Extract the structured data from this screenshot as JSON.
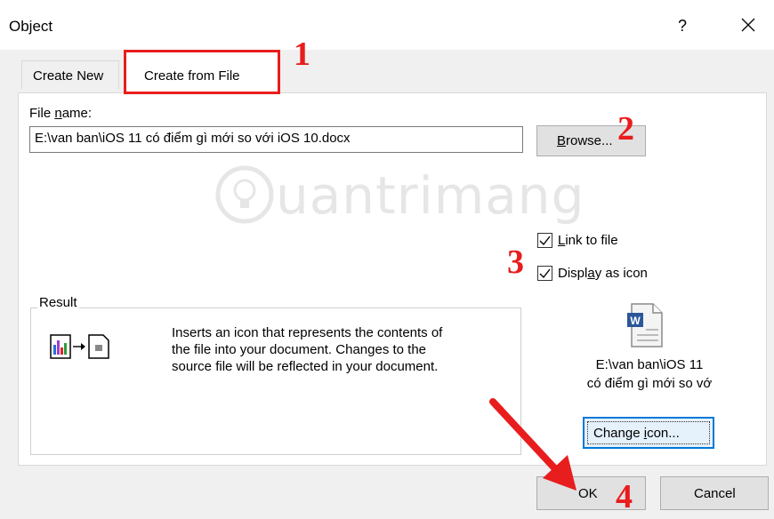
{
  "window": {
    "title": "Object",
    "help": "?"
  },
  "tabs": [
    {
      "label": "Create New"
    },
    {
      "label": "Create from File"
    }
  ],
  "file": {
    "label_pre": "File ",
    "label_key": "n",
    "label_post": "ame:",
    "value": "E:\\van ban\\iOS 11 có điểm gì mới so với iOS 10.docx"
  },
  "browse": {
    "key": "B",
    "rest": "rowse..."
  },
  "watermark": {
    "text": "uantrimang"
  },
  "options": {
    "link": {
      "key": "L",
      "rest": "ink to file",
      "checked": true
    },
    "display": {
      "pre": "Displ",
      "key": "a",
      "post": "y as icon",
      "checked": true
    }
  },
  "result": {
    "label": "Result",
    "description_lines": [
      "Inserts an icon that represents the contents of",
      "the file into your document. Changes to the",
      "source file will be reflected in your document."
    ]
  },
  "icon_caption": [
    "E:\\van ban\\iOS 11",
    "có điểm gì mới so vớ"
  ],
  "change_icon": {
    "pre": "Change ",
    "key": "i",
    "post": "con..."
  },
  "buttons": {
    "ok": "OK",
    "cancel": "Cancel"
  },
  "annotations": [
    "1",
    "2",
    "3",
    "4"
  ],
  "colors": {
    "annotation_red": "#e81d1d",
    "focus_blue": "#0078d7"
  }
}
